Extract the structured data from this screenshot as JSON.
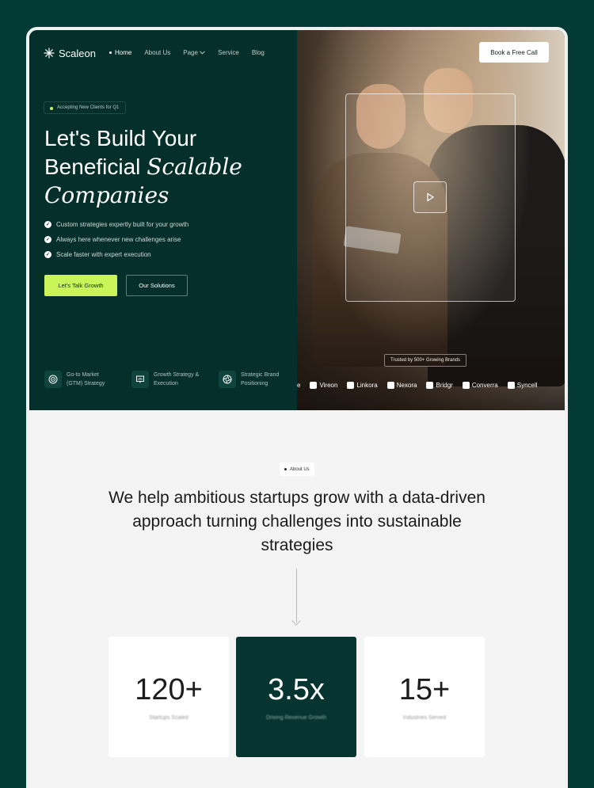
{
  "brand": {
    "name": "Scaleon"
  },
  "nav": {
    "items": [
      {
        "label": "Home"
      },
      {
        "label": "About Us"
      },
      {
        "label": "Page"
      },
      {
        "label": "Service"
      },
      {
        "label": "Blog"
      }
    ],
    "cta": "Book a Free Call"
  },
  "hero": {
    "badge": "Accepting New Clients for Q1",
    "headline_line1": "Let's Build Your",
    "headline_line2_plain": "Beneficial",
    "headline_line2_italic": "Scalable",
    "headline_line3_italic": "Companies",
    "checklist": [
      "Custom strategies expertly built for your growth",
      "Always here whenever new challenges arise",
      "Scale faster with expert execution"
    ],
    "primary_button": "Let's Talk Growth",
    "secondary_button": "Our Solutions",
    "features": [
      {
        "icon": "target-icon",
        "text": "Go-to Market (GTM) Strategy"
      },
      {
        "icon": "presentation-chart-icon",
        "text": "Growth Strategy & Execution"
      },
      {
        "icon": "aperture-icon",
        "text": "Strategic Brand Positioning"
      }
    ],
    "trusted_label": "Trusted by 500+ Growing Brands",
    "brands": [
      "e",
      "Vireon",
      "Linkora",
      "Nexora",
      "Bridgr",
      "Converra",
      "Syncell"
    ]
  },
  "about": {
    "pill": "About Us",
    "statement": "We help ambitious startups grow with a data-driven approach turning challenges into sustainable strategies"
  },
  "stats": [
    {
      "value": "120+",
      "label": "Startups Scaled"
    },
    {
      "value": "3.5x",
      "label": "Driving Revenue Growth"
    },
    {
      "value": "15+",
      "label": "Industries Served"
    }
  ],
  "colors": {
    "background": "#033a36",
    "hero_dark": "#052f2b",
    "accent_lime": "#c9f55a",
    "stat_dark": "#063430"
  }
}
